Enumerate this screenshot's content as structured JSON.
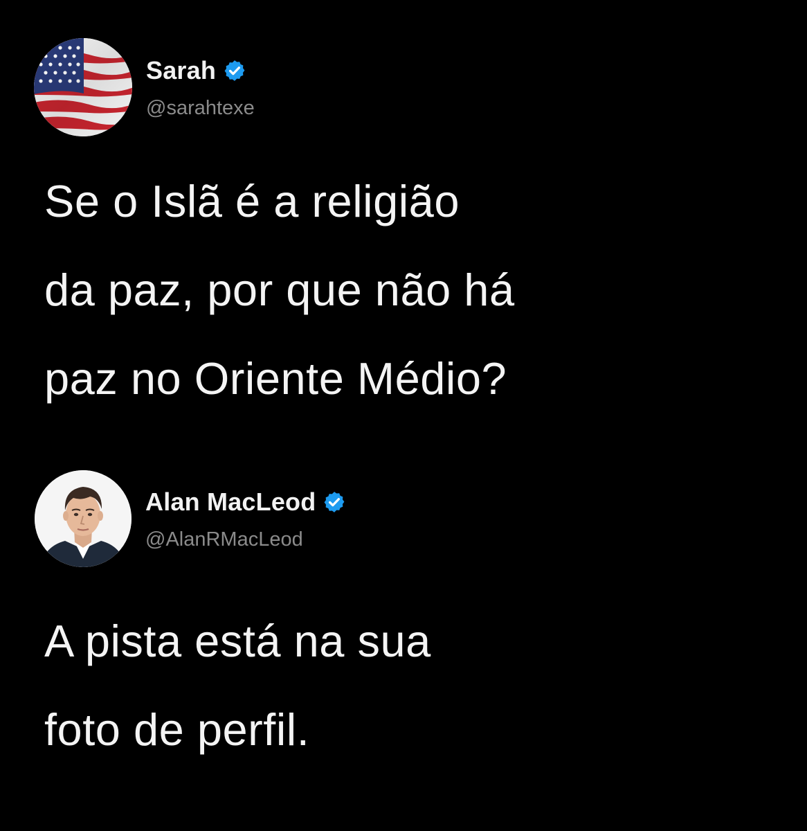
{
  "tweets": [
    {
      "display_name": "Sarah",
      "handle": "@sarahtexe",
      "verified": true,
      "avatar": "us-flag-avatar",
      "text_lines": [
        "Se o Islã é a religião",
        "da paz, por que não há",
        "paz no Oriente Médio?"
      ]
    },
    {
      "display_name": "Alan MacLeod",
      "handle": "@AlanRMacLeod",
      "verified": true,
      "avatar": "man-portrait-avatar",
      "text_lines": [
        "A pista está na sua",
        "foto de perfil."
      ]
    }
  ],
  "colors": {
    "background": "#000000",
    "text": "#f4f4f4",
    "handle": "#8b8b8b",
    "verified_badge": "#1d9bf0"
  }
}
